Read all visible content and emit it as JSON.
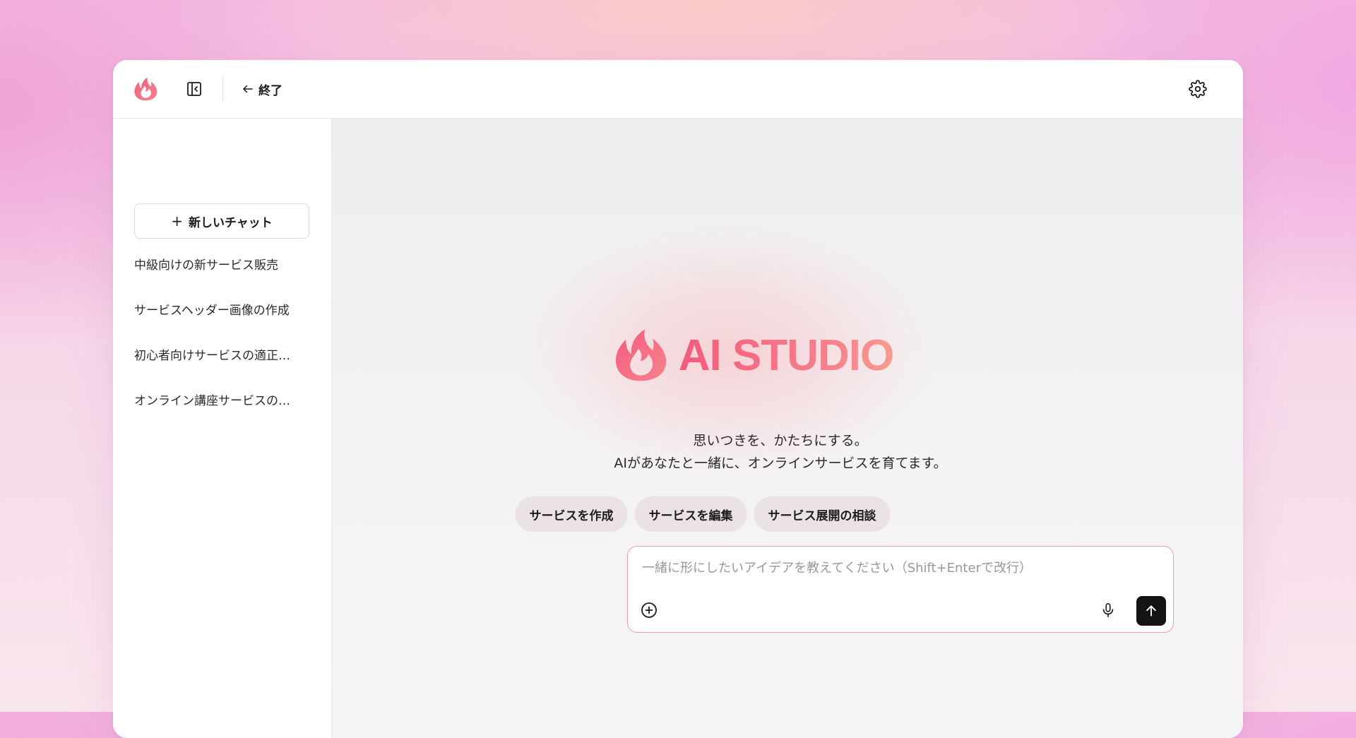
{
  "topbar": {
    "exit_label": "終了",
    "icons": {
      "logo": "flame-logo",
      "sidebar_toggle": "sidebar-collapse-icon",
      "back": "arrow-left-icon",
      "settings": "gear-icon"
    }
  },
  "sidebar": {
    "new_chat_label": "新しいチャット",
    "history": [
      "中級向けの新サービス販売",
      "サービスヘッダー画像の作成",
      "初心者向けサービスの適正…",
      "オンライン講座サービスの…"
    ]
  },
  "main": {
    "brand_name": "AI STUDIO",
    "tagline_line1": "思いつきを、かたちにする。",
    "tagline_line2": "AIがあなたと一緒に、オンラインサービスを育てます。",
    "suggestions": [
      "サービスを作成",
      "サービスを編集",
      "サービス展開の相談"
    ],
    "composer": {
      "placeholder": "一緒に形にしたいアイデアを教えてください（Shift+Enterで改行）",
      "value": "",
      "icons": {
        "attach": "plus-circle-icon",
        "mic": "microphone-icon",
        "send": "arrow-up-icon"
      }
    }
  },
  "colors": {
    "brand_gradient_start": "#f35a7a",
    "brand_gradient_end": "#f99a8e",
    "composer_border": "#f19aa8",
    "send_button": "#141416",
    "chip_background": "#ebe2e3"
  }
}
